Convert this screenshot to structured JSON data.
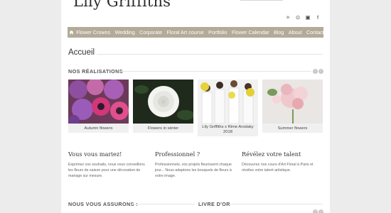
{
  "site": {
    "brand": "Lily Griffiths"
  },
  "social": [
    {
      "icon": "twitter-icon",
      "glyph": "✧"
    },
    {
      "icon": "pinterest-icon",
      "glyph": "⊙"
    },
    {
      "icon": "instagram-icon",
      "glyph": "▣"
    },
    {
      "icon": "facebook-icon",
      "glyph": "f"
    }
  ],
  "nav": {
    "home_icon": "⌂",
    "items": [
      "Flower Crowns",
      "Wedding",
      "Corporate",
      "Floral Art course",
      "Portfolio",
      "Flower Calendar",
      "Blog",
      "About",
      "Contact"
    ]
  },
  "page_title": "Accueil",
  "realisations": {
    "heading": "NOS RÉALISATIONS",
    "prev": "‹",
    "next": "›",
    "items": [
      {
        "caption": "Autumn flowers"
      },
      {
        "caption": "Flowers in winter"
      },
      {
        "caption": "Lily Griffiths x Rime Arodaky 2018"
      },
      {
        "caption": "Summer flowers"
      }
    ]
  },
  "columns": [
    {
      "title": "Vous vous mariez!",
      "text": "Exprimez vos souhaits, nous vous conseillons les fleurs de saison pour une décoration de mariage sur mesure."
    },
    {
      "title": "Professionnel ?",
      "text": "Professionnels, vos projets fleurissent chaque jour... Nous adaptons les bouquets de fleurs à votre image."
    },
    {
      "title": "Révélez votre talent",
      "text": "Découvrez nos cours d'Art Floral à Paris et révélez votre talent artistique."
    }
  ],
  "bottom": {
    "left_heading": "NOUS VOUS ASSURONS :",
    "right_heading": "LIVRE D'OR"
  },
  "colors": {
    "nav_bg": "#b3aa98",
    "page_bg": "#ffffff",
    "outer_bg": "#ececec"
  }
}
